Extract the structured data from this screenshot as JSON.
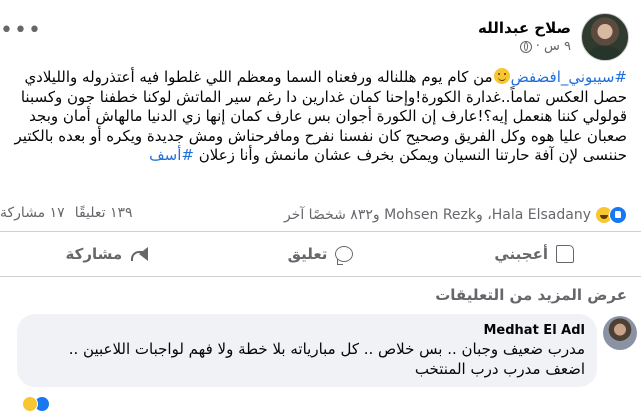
{
  "post": {
    "author": "صلاح عبدالله",
    "time": "٩ س ·",
    "options_icon": "more-dots-icon",
    "privacy_icon": "globe-icon",
    "text": {
      "hashtag_1": "#سيبوني_افضفض",
      "line_1": "من كام يوم هللناله ورفعناه السما ومعظم اللي غلطوا فيه أعتذروله والليلادي حصل العكس تماماً..غدارة الكورة!وإحنا كمان غدارين دا رغم سير الماتش لوكنا خطفنا جون وكسبنا قولولي كننا هنعمل إيه؟!عارف إن الكورة أجوان بس عارف كمان إنها زي الدنيا مالهاش أمان وبجد صعبان عليا هوه وكل الفريق وصحيح كان نفسنا نفرح ومافرحناش ومش جديدة ويكره أو بعده بالكتير حننسى لإن آفة حارتنا النسيان ويمكن بخرف عشان مانمش وأنا زعلان",
      "hashtag_2": "#أسف"
    }
  },
  "reactions": {
    "names": "Hala Elsadany، وMohsen Rezk و٨٣٢ شخصًا آخر",
    "comments_count": "١٣٩ تعليقًا",
    "shares_count": "١٧ مشاركة"
  },
  "actions": {
    "like": "أعجبني",
    "comment": "تعليق",
    "share": "مشاركة"
  },
  "comments": {
    "view_more": "عرض المزيد من التعليقات",
    "first": {
      "author": "Medhat El Adl",
      "text": "مدرب ضعيف وجبان .. بس خلاص .. كل مبارياته بلا خطة ولا فهم لواجبات اللاعبين .. اضعف مدرب درب المنتخب"
    }
  },
  "colors": {
    "link": "#216fdb",
    "secondary_text": "#65676b",
    "like_blue": "#1877f2",
    "bubble_bg": "#f0f2f5"
  }
}
